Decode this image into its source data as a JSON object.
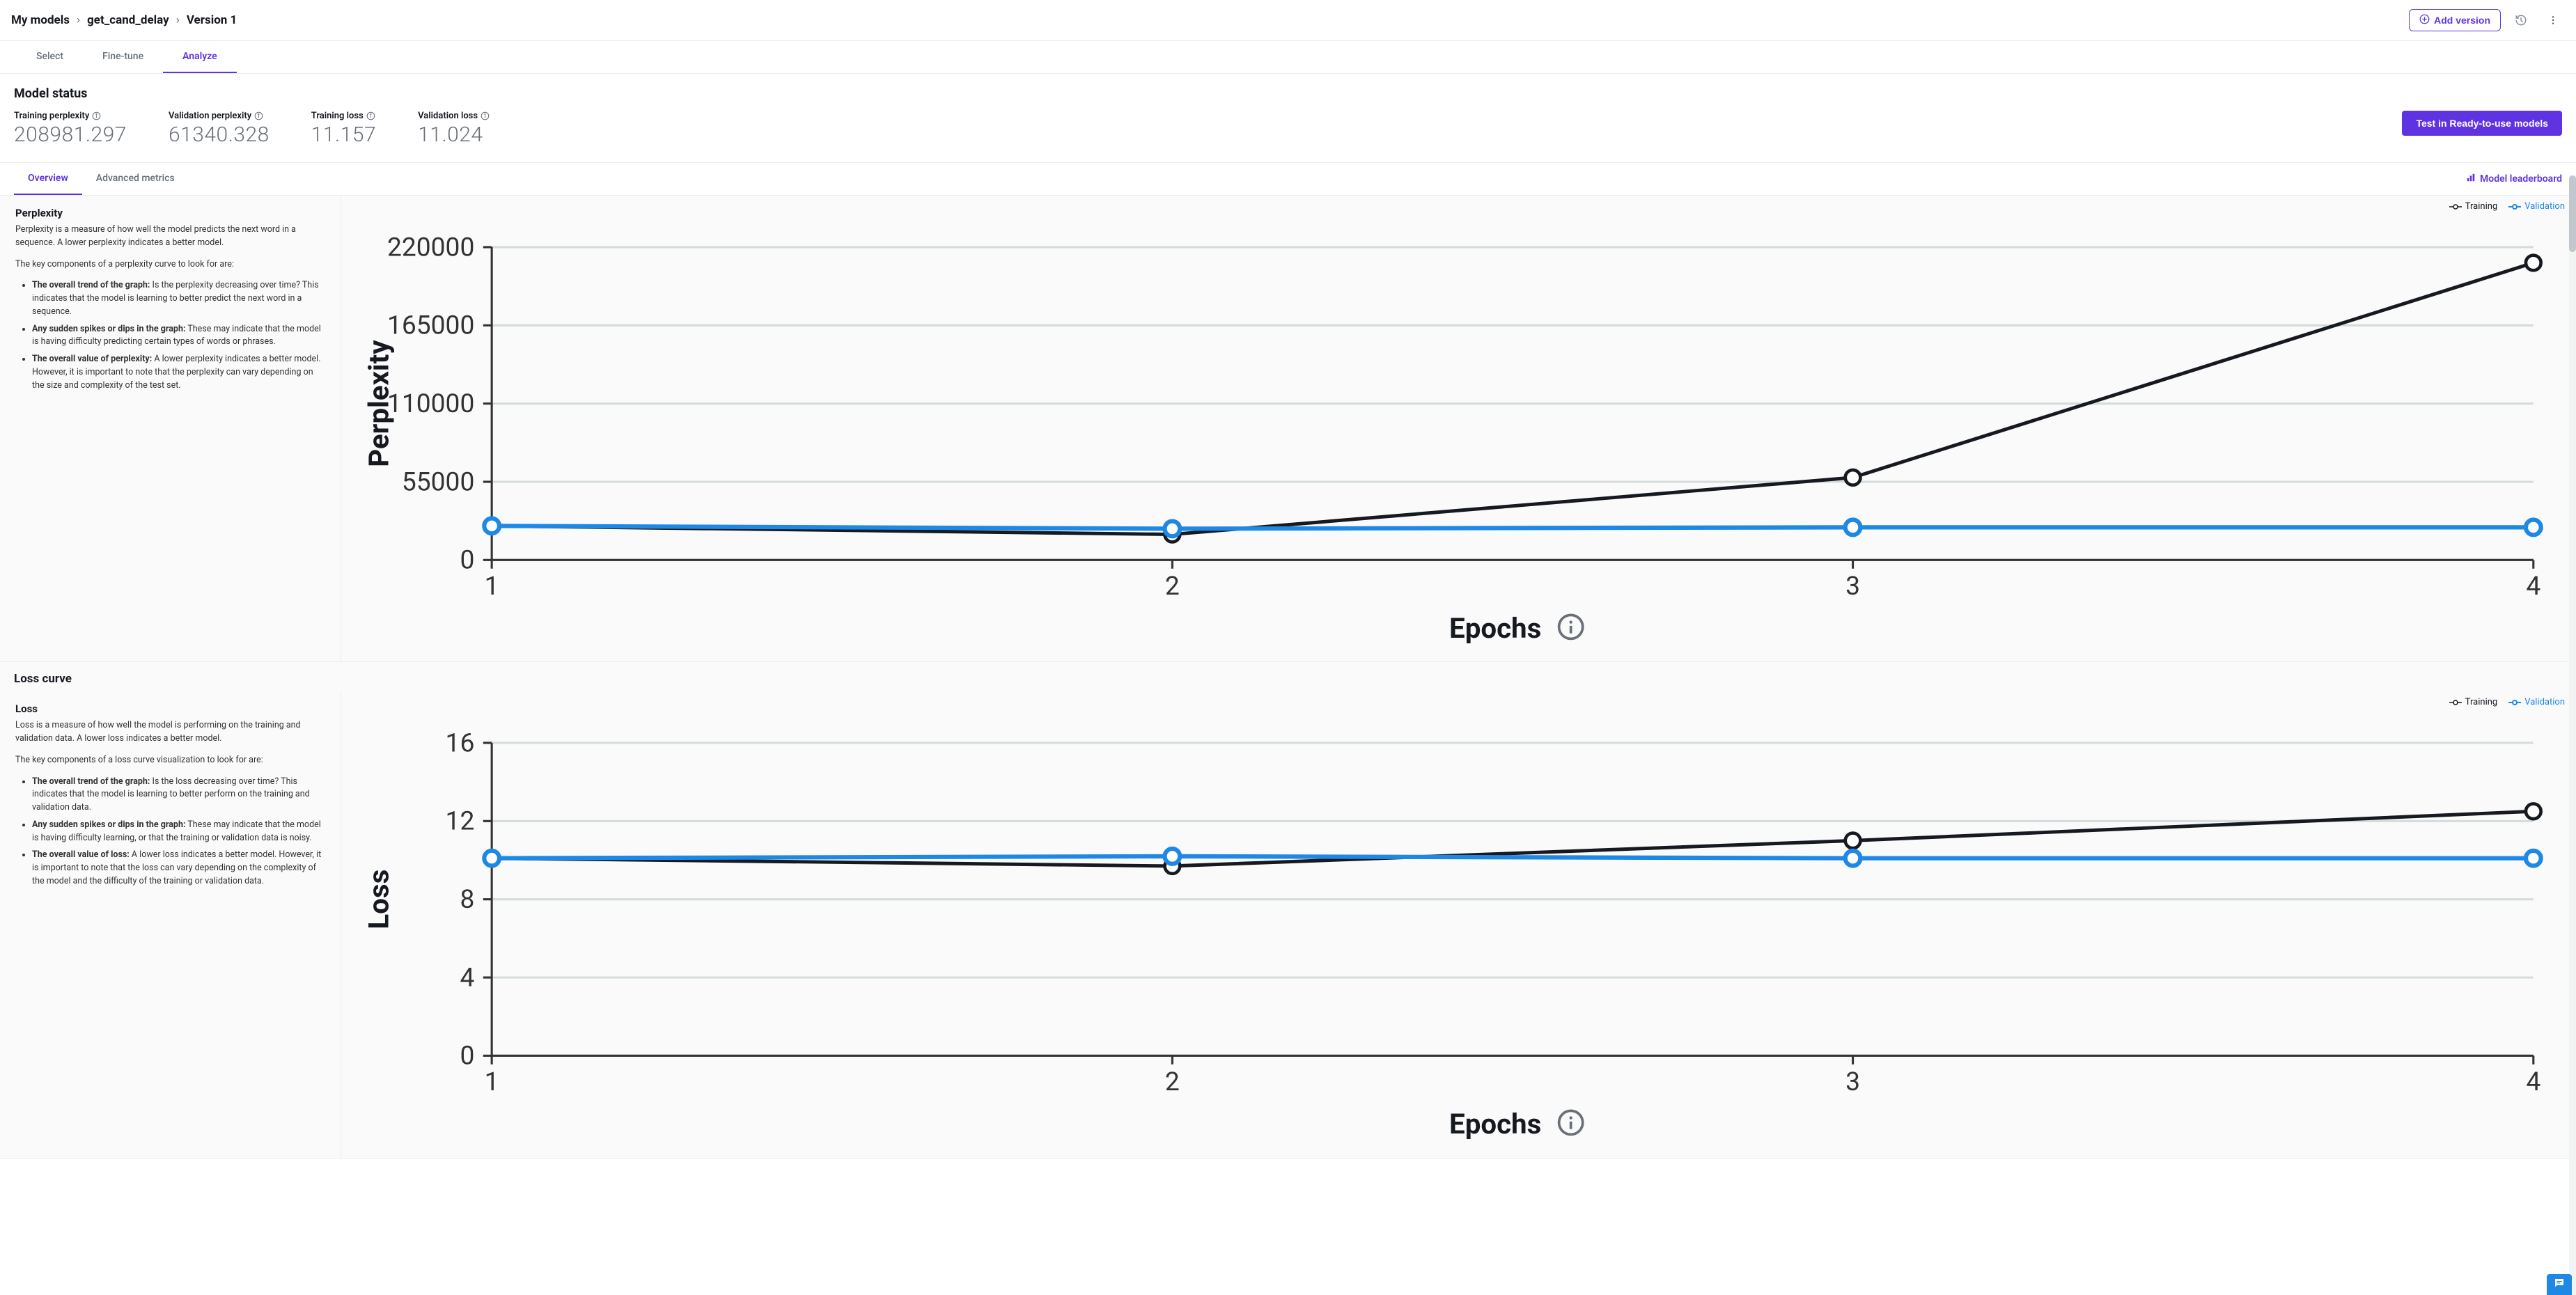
{
  "breadcrumb": [
    "My models",
    "get_cand_delay",
    "Version 1"
  ],
  "topbar": {
    "add_version": "Add version"
  },
  "tabs": {
    "items": [
      "Select",
      "Fine-tune",
      "Analyze"
    ],
    "active": 2
  },
  "status": {
    "title": "Model status",
    "metrics": [
      {
        "label": "Training perplexity",
        "value": "208981.297"
      },
      {
        "label": "Validation perplexity",
        "value": "61340.328"
      },
      {
        "label": "Training loss",
        "value": "11.157"
      },
      {
        "label": "Validation loss",
        "value": "11.024"
      }
    ],
    "test_button": "Test in Ready-to-use models"
  },
  "subtabs": {
    "items": [
      "Overview",
      "Advanced metrics"
    ],
    "active": 0,
    "leaderboard": "Model leaderboard"
  },
  "perplexity_panel": {
    "heading": "Perplexity",
    "desc": "Perplexity is a measure of how well the model predicts the next word in a sequence. A lower perplexity indicates a better model.",
    "components_intro": "The key components of a perplexity curve to look for are:",
    "bullets": [
      {
        "bold": "The overall trend of the graph:",
        "text": " Is the perplexity decreasing over time? This indicates that the model is learning to better predict the next word in a sequence."
      },
      {
        "bold": "Any sudden spikes or dips in the graph:",
        "text": " These may indicate that the model is having difficulty predicting certain types of words or phrases."
      },
      {
        "bold": "The overall value of perplexity:",
        "text": " A lower perplexity indicates a better model. However, it is important to note that the perplexity can vary depending on the size and complexity of the test set."
      }
    ]
  },
  "loss_section_heading": "Loss curve",
  "loss_panel": {
    "heading": "Loss",
    "desc": "Loss is a measure of how well the model is performing on the training and validation data. A lower loss indicates a better model.",
    "components_intro": "The key components of a loss curve visualization to look for are:",
    "bullets": [
      {
        "bold": "The overall trend of the graph:",
        "text": " Is the loss decreasing over time? This indicates that the model is learning to better perform on the training and validation data."
      },
      {
        "bold": "Any sudden spikes or dips in the graph:",
        "text": " These may indicate that the model is having difficulty learning, or that the training or validation data is noisy."
      },
      {
        "bold": "The overall value of loss:",
        "text": " A lower loss indicates a better model. However, it is important to note that the loss can vary depending on the complexity of the model and the difficulty of the training or validation data."
      }
    ]
  },
  "legend": {
    "training": "Training",
    "validation": "Validation"
  },
  "axis_label_epochs": "Epochs",
  "axis_label_perplexity": "Perplexity",
  "axis_label_loss": "Loss",
  "chart_data": [
    {
      "type": "line",
      "title": "Perplexity",
      "xlabel": "Epochs",
      "ylabel": "Perplexity",
      "x": [
        1,
        2,
        3,
        4
      ],
      "x_ticks": [
        1,
        2,
        3,
        4
      ],
      "y_ticks": [
        0,
        55000,
        110000,
        165000,
        220000
      ],
      "ylim": [
        0,
        220000
      ],
      "series": [
        {
          "name": "Training",
          "color": "#16191f",
          "values": [
            24000,
            18000,
            58000,
            208981
          ]
        },
        {
          "name": "Validation",
          "color": "#1e88e5",
          "values": [
            24000,
            22000,
            23000,
            23000
          ]
        }
      ]
    },
    {
      "type": "line",
      "title": "Loss",
      "xlabel": "Epochs",
      "ylabel": "Loss",
      "x": [
        1,
        2,
        3,
        4
      ],
      "x_ticks": [
        1,
        2,
        3,
        4
      ],
      "y_ticks": [
        0,
        4,
        8,
        12,
        16
      ],
      "ylim": [
        0,
        16
      ],
      "series": [
        {
          "name": "Training",
          "color": "#16191f",
          "values": [
            10.1,
            9.7,
            11.0,
            12.5
          ]
        },
        {
          "name": "Validation",
          "color": "#1e88e5",
          "values": [
            10.1,
            10.2,
            10.1,
            10.1
          ]
        }
      ]
    }
  ]
}
